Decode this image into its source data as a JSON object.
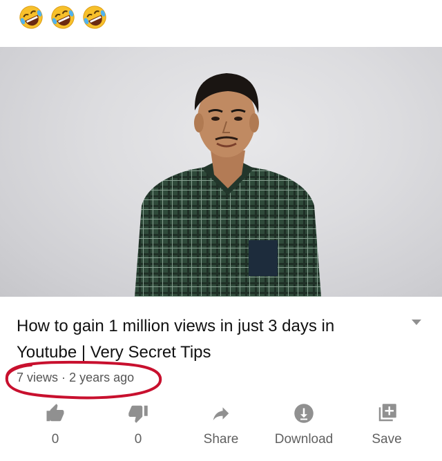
{
  "top_emojis": [
    "rofl-emoji",
    "rofl-emoji",
    "rofl-emoji"
  ],
  "video": {
    "title": "How to gain 1 million views in just 3 days in Youtube | Very Secret Tips",
    "views": "7 views",
    "separator": "·",
    "age": "2 years ago"
  },
  "actions": {
    "like": {
      "label": "0",
      "icon": "thumbs-up-icon"
    },
    "dislike": {
      "label": "0",
      "icon": "thumbs-down-icon"
    },
    "share": {
      "label": "Share",
      "icon": "share-arrow-icon"
    },
    "download": {
      "label": "Download",
      "icon": "download-icon"
    },
    "save": {
      "label": "Save",
      "icon": "playlist-add-icon"
    }
  },
  "colors": {
    "annotation_circle": "#c8102e",
    "icon_gray": "#909090",
    "text_dark": "#111111",
    "text_meta": "#555555"
  }
}
